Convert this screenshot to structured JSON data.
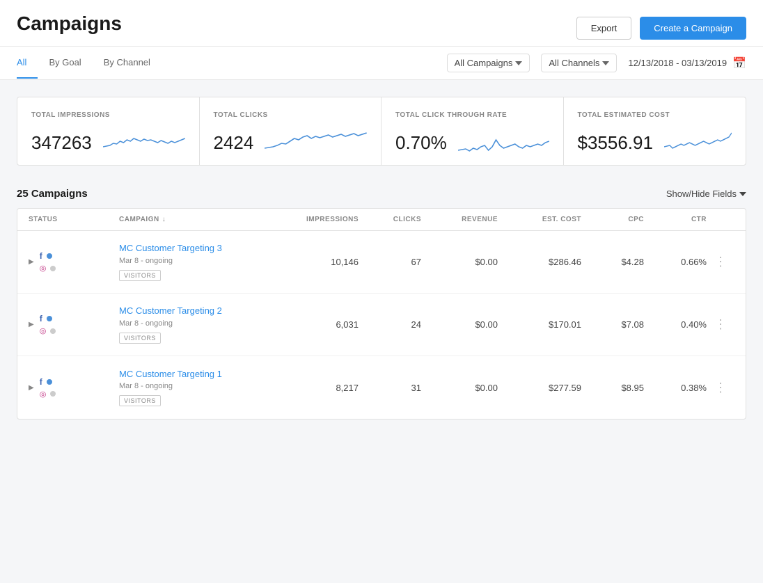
{
  "page": {
    "title": "Campaigns"
  },
  "header": {
    "export_label": "Export",
    "create_label": "Create a Campaign"
  },
  "tabs": [
    {
      "label": "All",
      "active": true
    },
    {
      "label": "By Goal",
      "active": false
    },
    {
      "label": "By Channel",
      "active": false
    }
  ],
  "filters": {
    "campaigns_label": "All Campaigns",
    "channels_label": "All Channels",
    "date_range": "12/13/2018 - 03/13/2019"
  },
  "stats": [
    {
      "label": "TOTAL IMPRESSIONS",
      "value": "347263"
    },
    {
      "label": "TOTAL CLICKS",
      "value": "2424"
    },
    {
      "label": "TOTAL CLICK THROUGH RATE",
      "value": "0.70%"
    },
    {
      "label": "TOTAL ESTIMATED COST",
      "value": "$3556.91"
    }
  ],
  "list": {
    "count_label": "25 Campaigns",
    "show_hide_label": "Show/Hide Fields"
  },
  "table": {
    "headers": [
      {
        "label": "STATUS",
        "sortable": false
      },
      {
        "label": "CAMPAIGN",
        "sortable": true
      },
      {
        "label": "IMPRESSIONS",
        "sortable": false
      },
      {
        "label": "CLICKS",
        "sortable": false
      },
      {
        "label": "REVENUE",
        "sortable": false
      },
      {
        "label": "EST. COST",
        "sortable": false
      },
      {
        "label": "CPC",
        "sortable": false
      },
      {
        "label": "CTR",
        "sortable": false
      },
      {
        "label": "",
        "sortable": false
      }
    ],
    "rows": [
      {
        "name": "MC Customer Targeting 3",
        "date": "Mar 8 - ongoing",
        "tag": "VISITORS",
        "impressions": "10,146",
        "clicks": "67",
        "revenue": "$0.00",
        "est_cost": "$286.46",
        "cpc": "$4.28",
        "ctr": "0.66%"
      },
      {
        "name": "MC Customer Targeting 2",
        "date": "Mar 8 - ongoing",
        "tag": "VISITORS",
        "impressions": "6,031",
        "clicks": "24",
        "revenue": "$0.00",
        "est_cost": "$170.01",
        "cpc": "$7.08",
        "ctr": "0.40%"
      },
      {
        "name": "MC Customer Targeting 1",
        "date": "Mar 8 - ongoing",
        "tag": "VISITORS",
        "impressions": "8,217",
        "clicks": "31",
        "revenue": "$0.00",
        "est_cost": "$277.59",
        "cpc": "$8.95",
        "ctr": "0.38%"
      }
    ]
  }
}
